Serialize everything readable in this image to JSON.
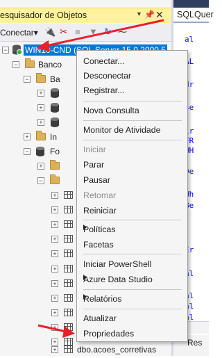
{
  "object_explorer": {
    "title": "esquisador de Objetos",
    "pin_icon": "pin-icon",
    "close_symbol": "✕",
    "toolbar": {
      "connect_label": "Conectar▾"
    },
    "server_node": "WIN10-CND (SQL Server 15.0.2000.5",
    "tree": {
      "bancos": "Banco",
      "bancos_sub": "Ba",
      "in": "In",
      "fo": "Fo",
      "last_table": "dbo.acoes_corretivas"
    }
  },
  "editor": {
    "tab_label": "SQLQuer",
    "zoom": "%",
    "results_label": "Res",
    "lines": [
      {
        "text": "al",
        "cls": "kw"
      },
      {
        "text": "AL",
        "cls": "kw"
      },
      {
        "text": "dr",
        "cls": "kw"
      },
      {
        "text": "se",
        "cls": "kw"
      },
      {
        "text": "ir",
        "cls": "kw"
      },
      {
        "text": "FR",
        "cls": "kw"
      },
      {
        "text": "WH",
        "cls": "kw"
      },
      {
        "text": "De",
        "cls": "kw"
      },
      {
        "text": "Wh",
        "cls": "kw"
      },
      {
        "text": "Be",
        "cls": "kw"
      },
      {
        "text": "Er",
        "cls": "kw"
      },
      {
        "text": "al",
        "cls": "kw"
      },
      {
        "text": "al",
        "cls": "kw"
      },
      {
        "text": "al",
        "cls": "kw"
      },
      {
        "text": "al",
        "cls": "kw"
      }
    ]
  },
  "context_menu": {
    "items": [
      {
        "label": "Conectar...",
        "enabled": true
      },
      {
        "label": "Desconectar",
        "enabled": true
      },
      {
        "label": "Registrar...",
        "enabled": true
      },
      {
        "label": "Nova Consulta",
        "enabled": true
      },
      {
        "label": "Monitor de Atividade",
        "enabled": true
      },
      {
        "label": "Iniciar",
        "enabled": false
      },
      {
        "label": "Parar",
        "enabled": true
      },
      {
        "label": "Pausar",
        "enabled": true
      },
      {
        "label": "Retomar",
        "enabled": false
      },
      {
        "label": "Reiniciar",
        "enabled": true
      },
      {
        "label": "Políticas",
        "enabled": true,
        "submenu": true
      },
      {
        "label": "Facetas",
        "enabled": true
      },
      {
        "label": "Iniciar PowerShell",
        "enabled": true
      },
      {
        "label": "Azure Data Studio",
        "enabled": true,
        "submenu": true
      },
      {
        "label": "Relatórios",
        "enabled": true,
        "submenu": true
      },
      {
        "label": "Atualizar",
        "enabled": true
      },
      {
        "label": "Propriedades",
        "enabled": true
      }
    ]
  },
  "colors": {
    "title_bar": "#fff29d",
    "selection": "#0078d7",
    "annotation_arrow": "#e8202a",
    "keyword": "#0000ff"
  }
}
